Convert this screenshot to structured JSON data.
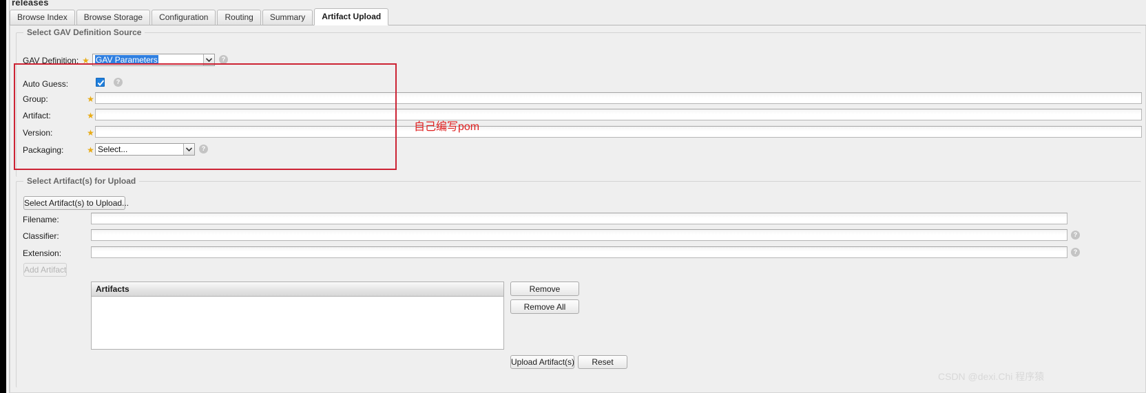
{
  "page": {
    "heading": "releases"
  },
  "tabs": [
    {
      "label": "Browse Index",
      "active": false
    },
    {
      "label": "Browse Storage",
      "active": false
    },
    {
      "label": "Configuration",
      "active": false
    },
    {
      "label": "Routing",
      "active": false
    },
    {
      "label": "Summary",
      "active": false
    },
    {
      "label": "Artifact Upload",
      "active": true
    }
  ],
  "gav_section": {
    "legend": "Select GAV Definition Source",
    "gav_definition": {
      "label": "GAV Definition:",
      "value": "GAV Parameters",
      "help": "?"
    },
    "auto_guess": {
      "label": "Auto Guess:",
      "checked": true,
      "help": "?"
    },
    "group": {
      "label": "Group:",
      "value": "",
      "placeholder": ""
    },
    "artifact": {
      "label": "Artifact:",
      "value": "",
      "placeholder": ""
    },
    "version": {
      "label": "Version:",
      "value": "",
      "placeholder": ""
    },
    "packaging": {
      "label": "Packaging:",
      "value": "Select...",
      "help": "?"
    }
  },
  "annotation": {
    "text": "自己编写pom",
    "color": "#e02020"
  },
  "upload_section": {
    "legend": "Select Artifact(s) for Upload",
    "select_button": "Select Artifact(s) to Upload...",
    "filename": {
      "label": "Filename:",
      "value": "",
      "placeholder": ""
    },
    "classifier": {
      "label": "Classifier:",
      "value": "",
      "placeholder": "",
      "help": "?"
    },
    "extension": {
      "label": "Extension:",
      "value": "",
      "placeholder": "",
      "help": "?"
    },
    "add_artifact_button": {
      "label": "Add Artifact",
      "disabled": true
    },
    "artifacts_table": {
      "header": "Artifacts",
      "rows": []
    },
    "remove_button": "Remove",
    "remove_all_button": "Remove All"
  },
  "footer": {
    "upload_button": "Upload Artifact(s)",
    "reset_button": "Reset"
  },
  "watermark": {
    "text": "CSDN @dexi.Chi 程序猿"
  },
  "icons": {
    "help": "help-circle-icon",
    "chevron_down": "chevron-down-icon",
    "check": "check-icon",
    "star": "required-star-icon"
  },
  "colors": {
    "accent_red": "#cc2233",
    "checkbox_blue": "#1e7fdd",
    "select_highlight": "#2f7fe0",
    "star_gold": "#e8ab16"
  }
}
